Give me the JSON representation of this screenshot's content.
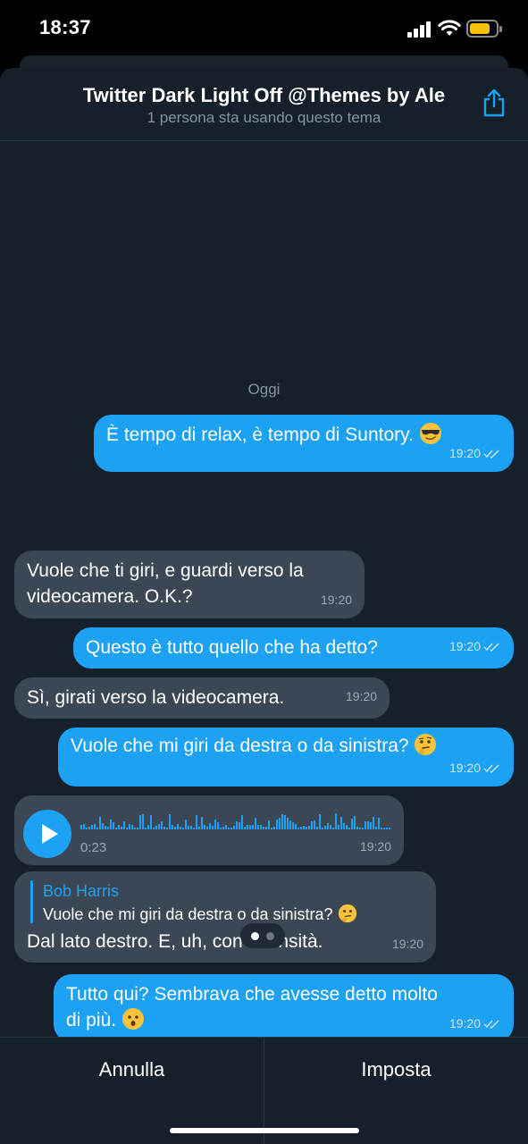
{
  "status_bar": {
    "time": "18:37"
  },
  "header": {
    "title": "Twitter Dark Light Off @Themes by Ale",
    "subtitle": "1 persona sta usando questo tema"
  },
  "chat": {
    "date_label": "Oggi",
    "messages": [
      {
        "text": "È tempo di relax, è tempo di Suntory.",
        "time": "19:20",
        "emoji": "sunglasses-emoji"
      },
      {
        "text_line1": "Vuole che ti giri, e guardi verso la",
        "text_line2": "videocamera. O.K.?",
        "time": "19:20"
      },
      {
        "text": "Questo è tutto quello che ha detto?",
        "time": "19:20"
      },
      {
        "text": "Sì, girati verso la videocamera.",
        "time": "19:20"
      },
      {
        "text": "Vuole che mi giri da destra o da sinistra?",
        "time": "19:20",
        "emoji": "thinking-emoji"
      },
      {
        "voice_duration": "0:23",
        "time": "19:20"
      },
      {
        "reply_name": "Bob Harris",
        "reply_text": "Vuole che mi giri da destra o da sinistra?",
        "text": "Dal lato destro. E, uh, con intensità.",
        "time": "19:20",
        "emoji": "thinking-emoji"
      },
      {
        "text_line1": "Tutto qui? Sembrava che avesse detto molto",
        "text_line2": "di più.",
        "time": "19:20",
        "emoji": "hushed-emoji"
      }
    ]
  },
  "footer": {
    "cancel_label": "Annulla",
    "set_label": "Imposta"
  },
  "colors": {
    "background": "#15202b",
    "outgoing_bubble": "#1da1f2",
    "incoming_bubble": "#3b4754",
    "accent": "#1da1f2"
  },
  "page_indicator": {
    "pages": 2,
    "active": 1
  }
}
